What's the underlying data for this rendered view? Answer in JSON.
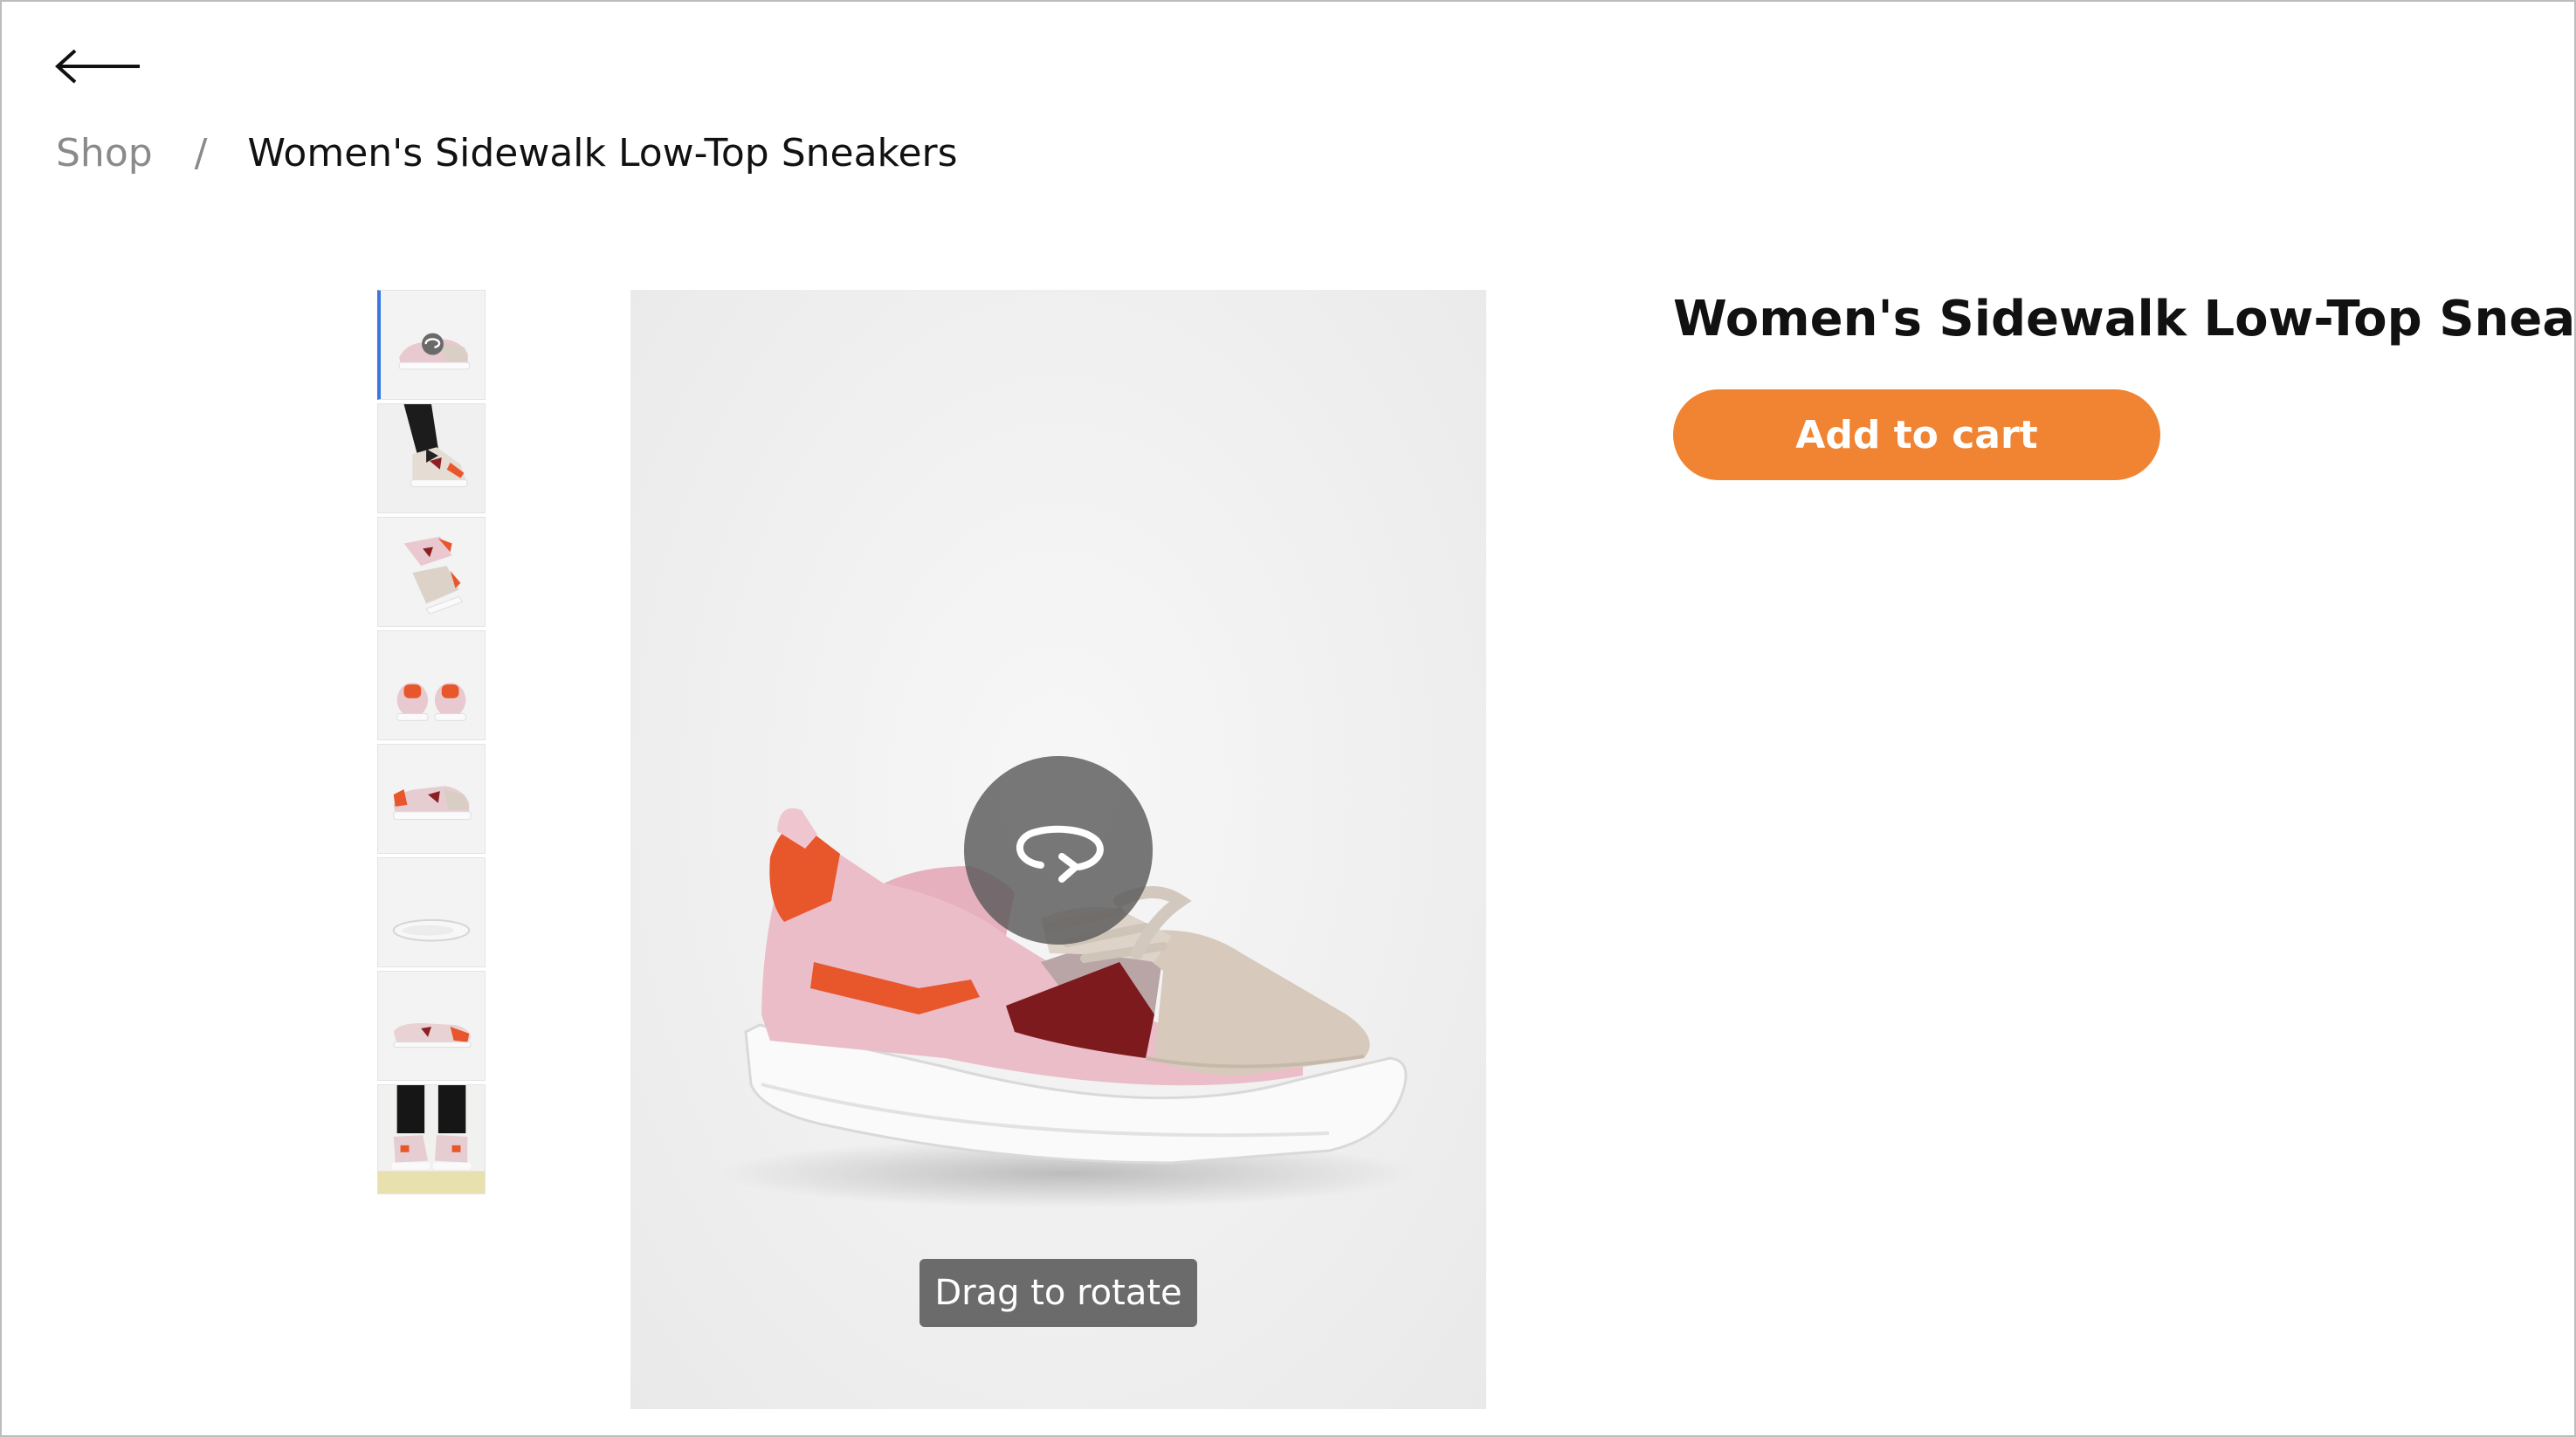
{
  "nav": {
    "back_icon": "arrow-left-icon"
  },
  "breadcrumb": {
    "items": [
      {
        "label": "Shop"
      },
      {
        "label": "/"
      },
      {
        "label": "Women's Sidewalk Low-Top Sneakers"
      }
    ]
  },
  "gallery": {
    "thumbnails": [
      {
        "kind": "360-view",
        "active": true
      },
      {
        "kind": "video",
        "active": false
      },
      {
        "kind": "image",
        "active": false
      },
      {
        "kind": "image",
        "active": false
      },
      {
        "kind": "image",
        "active": false
      },
      {
        "kind": "image",
        "active": false
      },
      {
        "kind": "image",
        "active": false
      },
      {
        "kind": "image",
        "active": false
      }
    ],
    "rotate_icon": "rotate-360-icon",
    "drag_hint": "Drag to rotate"
  },
  "product": {
    "title": "Women's Sidewalk Low-Top Sneakers",
    "add_to_cart_label": "Add to cart"
  },
  "colors": {
    "accent": "#f08432",
    "active_thumb": "#3a78e0"
  }
}
